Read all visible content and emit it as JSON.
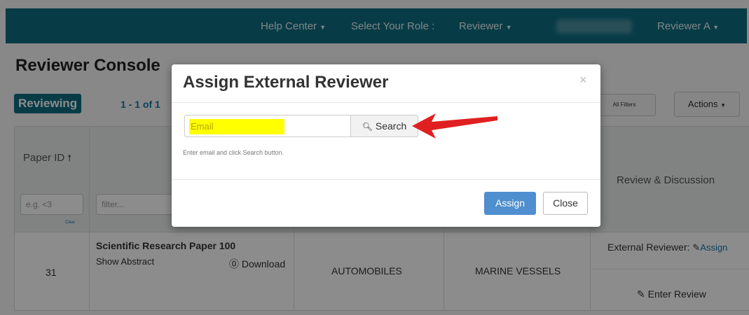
{
  "navbar": {
    "help_center": "Help Center",
    "select_role_label": "Select Your Role :",
    "role_value": "Reviewer",
    "user_name": "Reviewer A"
  },
  "page": {
    "title": "Reviewer Console",
    "tab_reviewing": "Reviewing",
    "paging": "1 - 1 of 1",
    "clear_all_filters": "All Filters",
    "actions_button": "Actions"
  },
  "table": {
    "col_paper_id": "Paper ID",
    "col_review_discussion": "Review & Discussion",
    "id_filter_placeholder": "e.g. <3",
    "clear_label": "Clear",
    "title_filter_placeholder": "filter...",
    "rows": [
      {
        "paper_id": "31",
        "title": "Scientific Research Paper 100",
        "show_abstract": "Show Abstract",
        "download": "Download",
        "primary_area": "AUTOMOBILES",
        "secondary_area": "MARINE VESSELS",
        "external_reviewer_label": "External Reviewer:",
        "assign_link": "Assign",
        "enter_review": "Enter Review"
      }
    ]
  },
  "modal": {
    "title": "Assign External Reviewer",
    "close_symbol": "×",
    "email_placeholder": "Email",
    "search_button": "Search",
    "help_text": "Enter email and click Search button.",
    "assign_button": "Assign",
    "close_button": "Close"
  },
  "colors": {
    "navbar": "#0e6e82",
    "primary_button": "#4f8fcf",
    "highlight": "#ffff00",
    "arrow": "#e02020"
  }
}
